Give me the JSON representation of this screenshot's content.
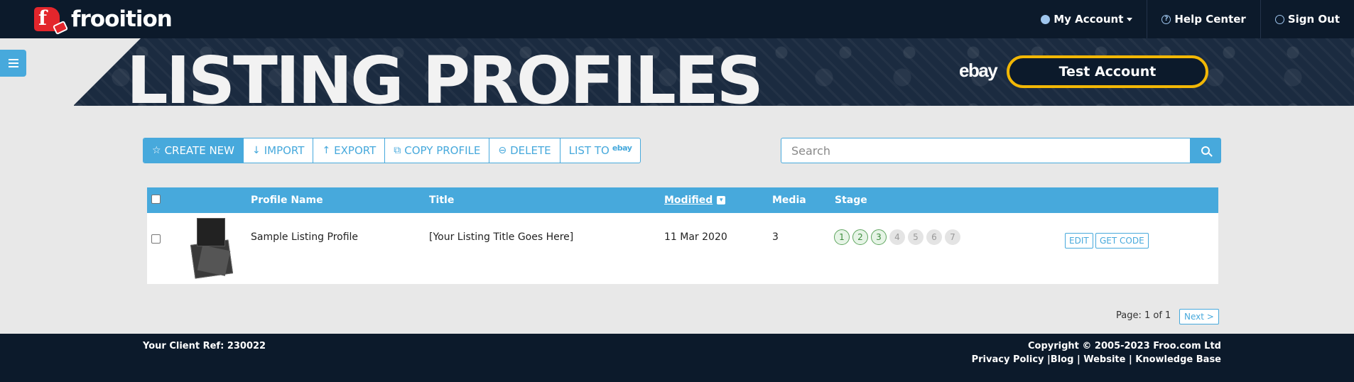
{
  "brand": {
    "name": "frooition",
    "colors": {
      "primary": "#47a9dc",
      "navy": "#0c1a2b",
      "red": "#e3262c",
      "gold": "#f2b705"
    }
  },
  "topnav": {
    "my_account": "My Account",
    "help_center": "Help Center",
    "sign_out": "Sign Out"
  },
  "banner": {
    "title": "LISTING PROFILES",
    "marketplace": "ebay",
    "account": "Test Account"
  },
  "toolbar": {
    "create_new": "CREATE NEW",
    "import": "IMPORT",
    "export": "EXPORT",
    "copy_profile": "COPY PROFILE",
    "delete": "DELETE",
    "list_to": "LIST TO",
    "list_to_brand": "ebay"
  },
  "search": {
    "placeholder": "Search"
  },
  "table": {
    "columns": {
      "profile_name": "Profile Name",
      "title": "Title",
      "modified": "Modified",
      "media": "Media",
      "stage": "Stage"
    },
    "rows": [
      {
        "profile_name": "Sample Listing Profile",
        "title": "[Your Listing Title Goes Here]",
        "modified": "11 Mar 2020",
        "media": "3",
        "stages": [
          "1",
          "2",
          "3",
          "4",
          "5",
          "6",
          "7"
        ],
        "stages_completed": 3,
        "edit": "EDIT",
        "get_code": "GET CODE"
      }
    ]
  },
  "pagination": {
    "label": "Page: 1 of 1",
    "next": "Next >"
  },
  "footer": {
    "client_ref": "Your Client Ref: 230022",
    "copyright": "Copyright © 2005-2023 Froo.com Ltd",
    "links": {
      "privacy": "Privacy Policy",
      "blog": "Blog",
      "website": "Website",
      "knowledge_base": "Knowledge Base"
    }
  }
}
